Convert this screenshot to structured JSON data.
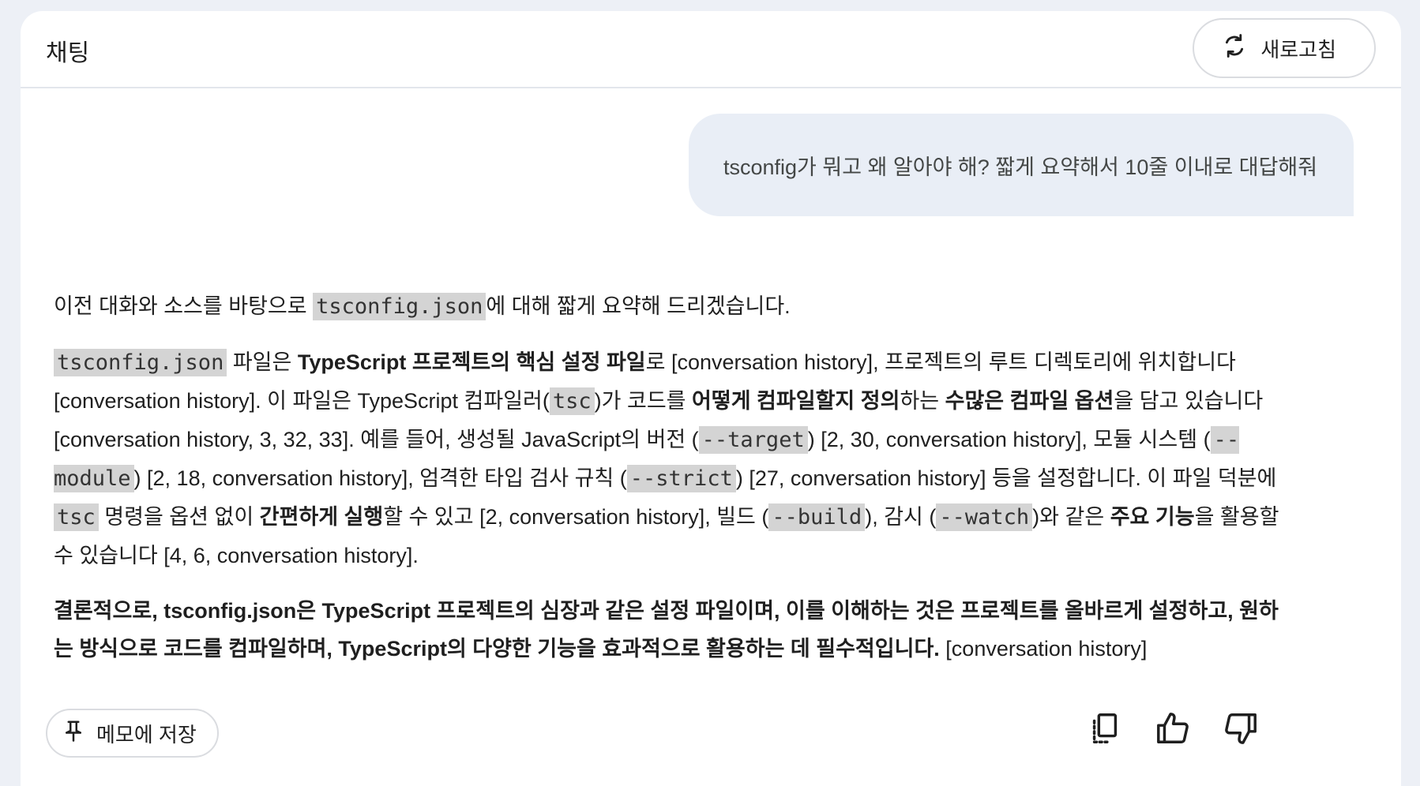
{
  "header": {
    "title": "채팅",
    "refresh_label": "새로고침"
  },
  "user_message": "tsconfig가 뭐고 왜 알아야 해? 짧게 요약해서 10줄 이내로 대답해줘",
  "answer": {
    "p1": {
      "t1": "이전 대화와 소스를 바탕으로 ",
      "c1": "tsconfig.json",
      "t2": "에 대해 짧게 요약해 드리겠습니다."
    },
    "p2": {
      "c1": "tsconfig.json",
      "t1": " 파일은 ",
      "b1": "TypeScript 프로젝트의 핵심 설정 파일",
      "t2": "로 [conversation history], 프로젝트의 루트 디렉토리에 위치합니다 [conversation history]. 이 파일은 TypeScript 컴파일러(",
      "c2": "tsc",
      "t3": ")가 코드를 ",
      "b2": "어떻게 컴파일할지 정의",
      "t4": "하는 ",
      "b3": "수많은 컴파일 옵션",
      "t5": "을 담고 있습니다 [conversation history, 3, 32, 33]. 예를 들어, 생성될 JavaScript의 버전 (",
      "c3": "--target",
      "t6": ") [2, 30, conversation history], 모듈 시스템 (",
      "c4": "--module",
      "t7": ") [2, 18, conversation history], 엄격한 타입 검사 규칙 (",
      "c5": "--strict",
      "t8": ") [27, conversation history] 등을 설정합니다. 이 파일 덕분에 ",
      "c6": "tsc",
      "t9": " 명령을 옵션 없이 ",
      "b4": "간편하게 실행",
      "t10": "할 수 있고 [2, conversation history], 빌드 (",
      "c7": "--build",
      "t11": "), 감시 (",
      "c8": "--watch",
      "t12": ")와 같은 ",
      "b5": "주요 기능",
      "t13": "을 활용할 수 있습니다 [4, 6, conversation history]."
    },
    "p3": {
      "b1": "결론적으로, tsconfig.json은 TypeScript 프로젝트의 심장과 같은 설정 파일이며, 이를 이해하는 것은 프로젝트를 올바르게 설정하고, 원하는 방식으로 코드를 컴파일하며, TypeScript의 다양한 기능을 효과적으로 활용하는 데 필수적입니다.",
      "t1": " [conversation history]"
    }
  },
  "footer": {
    "memo_label": "메모에 저장"
  },
  "icons": {
    "refresh": "refresh-icon",
    "pin": "pin-icon",
    "copy": "copy-icon",
    "thumbs_up": "thumbs-up-icon",
    "thumbs_down": "thumbs-down-icon"
  }
}
